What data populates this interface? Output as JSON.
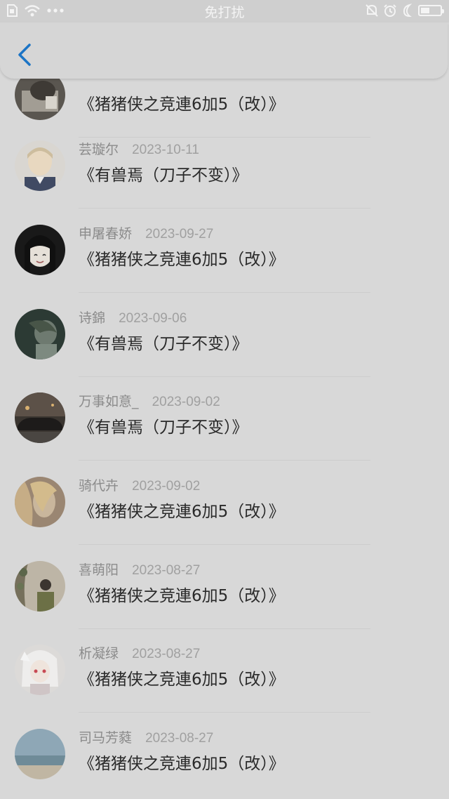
{
  "status_bar": {
    "center_text": "免打扰",
    "icons": [
      "sim-icon",
      "wifi-icon",
      "more-dots-icon",
      "mute-bell-icon",
      "alarm-icon",
      "moon-icon",
      "battery-icon"
    ],
    "battery_level": 0.45
  },
  "nav": {
    "back_icon": "chevron-left-icon",
    "accent_color": "#1b74c5"
  },
  "list": {
    "items": [
      {
        "name": "",
        "date": "",
        "title": "《猪猪侠之竞連6加5（改）》",
        "avatar": "dark-photo"
      },
      {
        "name": "芸璇尔",
        "date": "2023-10-11",
        "title": "《有兽焉（刀子不变）》",
        "avatar": "anime-boy"
      },
      {
        "name": "申屠春娇",
        "date": "2023-09-27",
        "title": "《猪猪侠之竞連6加5（改）》",
        "avatar": "anime-girl-dark-hair"
      },
      {
        "name": "诗錦",
        "date": "2023-09-06",
        "title": "《有兽焉（刀子不变）》",
        "avatar": "dark-green-photo"
      },
      {
        "name": "万事如意_",
        "date": "2023-09-02",
        "title": "《有兽焉（刀子不变）》",
        "avatar": "car-photo"
      },
      {
        "name": "骑代卉",
        "date": "2023-09-02",
        "title": "《猪猪侠之竞連6加5（改）》",
        "avatar": "blonde-girl-photo"
      },
      {
        "name": "喜萌阳",
        "date": "2023-08-27",
        "title": "《猪猪侠之竞連6加5（改）》",
        "avatar": "plants-photo"
      },
      {
        "name": "析凝绿",
        "date": "2023-08-27",
        "title": "《猪猪侠之竞連6加5（改）》",
        "avatar": "anime-white-hair"
      },
      {
        "name": "司马芳蕤",
        "date": "2023-08-27",
        "title": "《猪猪侠之竞連6加5（改）》",
        "avatar": "sea-photo"
      }
    ]
  }
}
